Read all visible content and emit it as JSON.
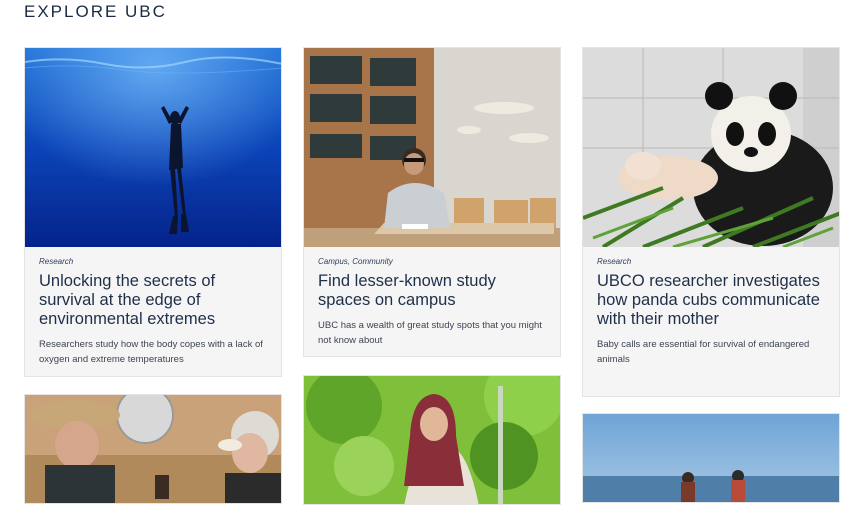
{
  "section": {
    "title": "EXPLORE UBC"
  },
  "cards": [
    {
      "tag": "Research",
      "title": "Unlocking the secrets of survival at the edge of environmental extremes",
      "description": "Researchers study how the body copes with a lack of oxygen and extreme temperatures",
      "image": "freediver-underwater-photo"
    },
    {
      "tag": "Campus, Community",
      "title": "Find lesser-known study spaces on campus",
      "description": "UBC has a wealth of great study spots that you might not know about",
      "image": "student-studying-in-atrium-photo"
    },
    {
      "tag": "Research",
      "title": "UBCO researcher investigates how panda cubs communicate with their mother",
      "description": "Baby calls are essential for survival of endangered animals",
      "image": "panda-with-cub-photo"
    },
    {
      "image": "people-at-table-photo"
    },
    {
      "image": "student-in-hijab-outdoors-photo"
    },
    {
      "image": "people-by-water-photo"
    }
  ],
  "colors": {
    "title": "#1f2f4a",
    "card_bg": "#f5f5f5",
    "text": "#3d4452"
  }
}
